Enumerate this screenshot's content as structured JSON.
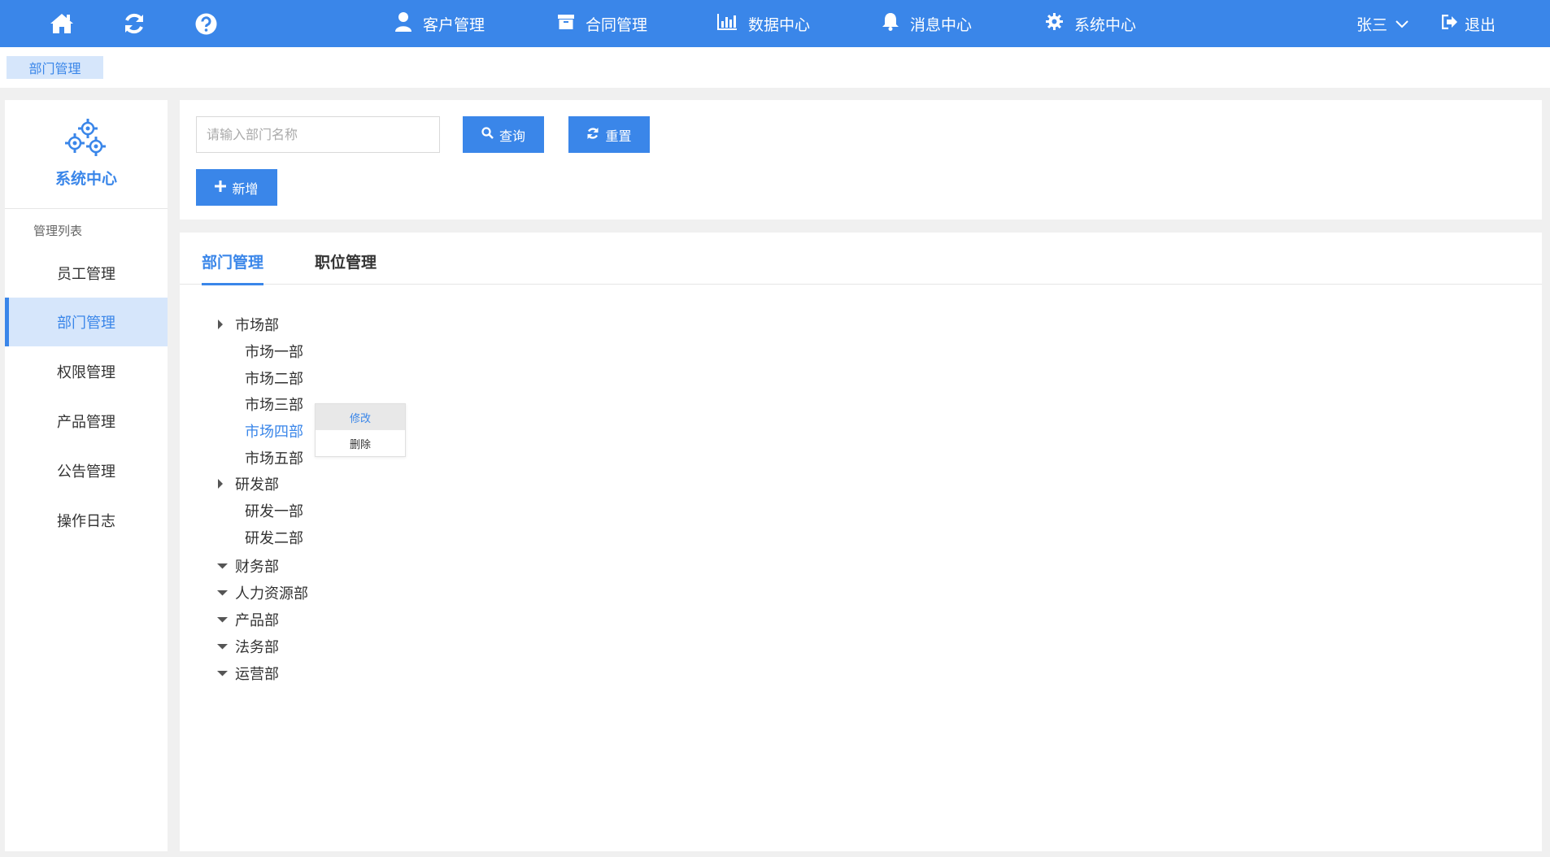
{
  "topbar": {
    "nav": [
      {
        "label": "客户管理",
        "icon": "user-icon"
      },
      {
        "label": "合同管理",
        "icon": "archive-icon"
      },
      {
        "label": "数据中心",
        "icon": "bar-chart-icon"
      },
      {
        "label": "消息中心",
        "icon": "bell-icon"
      },
      {
        "label": "系统中心",
        "icon": "gear-icon"
      }
    ],
    "user_name": "张三",
    "logout_label": "退出"
  },
  "breadcrumb": {
    "current": "部门管理"
  },
  "sidebar": {
    "title": "系统中心",
    "section_label": "管理列表",
    "items": [
      {
        "label": "员工管理",
        "active": false
      },
      {
        "label": "部门管理",
        "active": true
      },
      {
        "label": "权限管理",
        "active": false
      },
      {
        "label": "产品管理",
        "active": false
      },
      {
        "label": "公告管理",
        "active": false
      },
      {
        "label": "操作日志",
        "active": false
      }
    ]
  },
  "search": {
    "placeholder": "请输入部门名称",
    "query_label": "查询",
    "reset_label": "重置",
    "add_label": "新增"
  },
  "tabs": [
    {
      "label": "部门管理",
      "active": true
    },
    {
      "label": "职位管理",
      "active": false
    }
  ],
  "tree": [
    {
      "label": "市场部",
      "expanded": true,
      "children": [
        "市场一部",
        "市场二部",
        "市场三部",
        "市场四部",
        "市场五部"
      ]
    },
    {
      "label": "研发部",
      "expanded": true,
      "children": [
        "研发一部",
        "研发二部"
      ]
    },
    {
      "label": "财务部",
      "expanded": false,
      "children": []
    },
    {
      "label": "人力资源部",
      "expanded": false,
      "children": []
    },
    {
      "label": "产品部",
      "expanded": false,
      "children": []
    },
    {
      "label": "法务部",
      "expanded": false,
      "children": []
    },
    {
      "label": "运营部",
      "expanded": false,
      "children": []
    }
  ],
  "context_menu": {
    "target": "市场四部",
    "items": [
      "修改",
      "删除"
    ]
  },
  "colors": {
    "primary": "#3a86e9",
    "active_bg": "#d6e6fb"
  }
}
